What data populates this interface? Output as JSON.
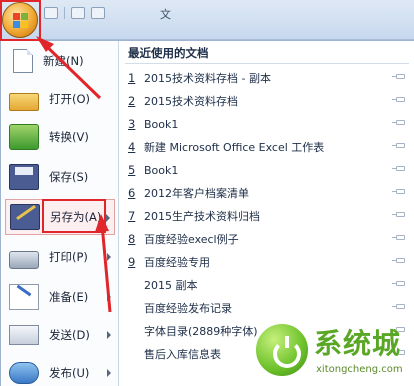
{
  "titlebar": {
    "title": "文"
  },
  "left_menu": {
    "items": [
      {
        "label": "新建(N)",
        "icon": "new-document-icon",
        "has_submenu": false
      },
      {
        "label": "打开(O)",
        "icon": "open-folder-icon",
        "has_submenu": false
      },
      {
        "label": "转换(V)",
        "icon": "convert-icon",
        "has_submenu": false
      },
      {
        "label": "保存(S)",
        "icon": "save-disk-icon",
        "has_submenu": false
      },
      {
        "label": "另存为(A)",
        "icon": "save-as-icon",
        "has_submenu": true
      },
      {
        "label": "打印(P)",
        "icon": "printer-icon",
        "has_submenu": true
      },
      {
        "label": "准备(E)",
        "icon": "prepare-icon",
        "has_submenu": true
      },
      {
        "label": "发送(D)",
        "icon": "send-icon",
        "has_submenu": true
      },
      {
        "label": "发布(U)",
        "icon": "publish-icon",
        "has_submenu": true
      }
    ]
  },
  "recent": {
    "title": "最近使用的文档",
    "items": [
      {
        "num": "1",
        "name": "2015技术资料存档 - 副本"
      },
      {
        "num": "2",
        "name": "2015技术资料存档"
      },
      {
        "num": "3",
        "name": "Book1"
      },
      {
        "num": "4",
        "name": "新建 Microsoft Office Excel 工作表"
      },
      {
        "num": "5",
        "name": "Book1"
      },
      {
        "num": "6",
        "name": "2012年客户档案清单"
      },
      {
        "num": "7",
        "name": "2015生产技术资料归档"
      },
      {
        "num": "8",
        "name": "百度经验execl例子"
      },
      {
        "num": "9",
        "name": "百度经验专用"
      },
      {
        "num": "",
        "name": "2015 副本"
      },
      {
        "num": "",
        "name": "百度经验发布记录"
      },
      {
        "num": "",
        "name": "字体目录(2889种字体)"
      },
      {
        "num": "",
        "name": "售后入库信息表"
      }
    ]
  },
  "watermark": {
    "text": "系统城",
    "url": "xitongcheng.com"
  },
  "colors": {
    "annotation": "#e0262b",
    "accent": "#3a6cc8"
  }
}
